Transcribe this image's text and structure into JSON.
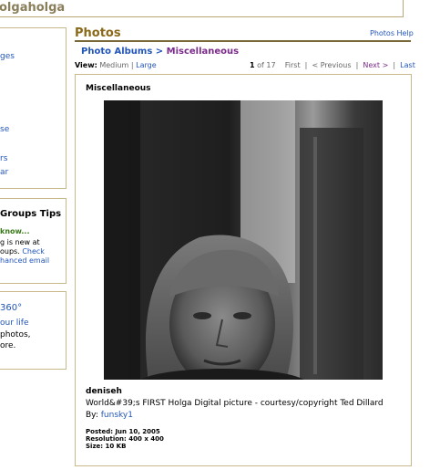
{
  "window": {
    "title": "olgaholga"
  },
  "sidebar": {
    "box1_links": [
      "ges",
      "se",
      "rs",
      "ar"
    ],
    "groups_tips": {
      "heading": "Groups Tips",
      "did_you_know": "know...",
      "text1": "g is new at",
      "text2": "oups.",
      "check": "Check",
      "link": "hanced email"
    },
    "box3": {
      "heading": "360°",
      "link": "our life",
      "text1": "photos,",
      "text2": "ore."
    }
  },
  "photos": {
    "title": "Photos",
    "help_label": "Photos Help",
    "breadcrumb": {
      "albums": "Photo Albums",
      "sep": ">",
      "current": "Miscellaneous"
    },
    "view_label": "View:",
    "view_medium": "Medium",
    "view_sep": "|",
    "view_large": "Large",
    "pager": {
      "current": "1",
      "of": "of",
      "total": "17",
      "first": "First",
      "prev": "< Previous",
      "next": "Next >",
      "last": "Last"
    }
  },
  "card": {
    "album_title": "Miscellaneous",
    "username": "deniseh",
    "caption": "World&#39;s FIRST Holga Digital picture - courtesy/copyright Ted Dillard",
    "by_label": "By:",
    "by_user": "funsky1",
    "posted_label": "Posted:",
    "posted_value": "Jun 10, 2005",
    "resolution_label": "Resolution:",
    "resolution_value": "400 x 400",
    "size_label": "Size:",
    "size_value": "10 KB"
  }
}
